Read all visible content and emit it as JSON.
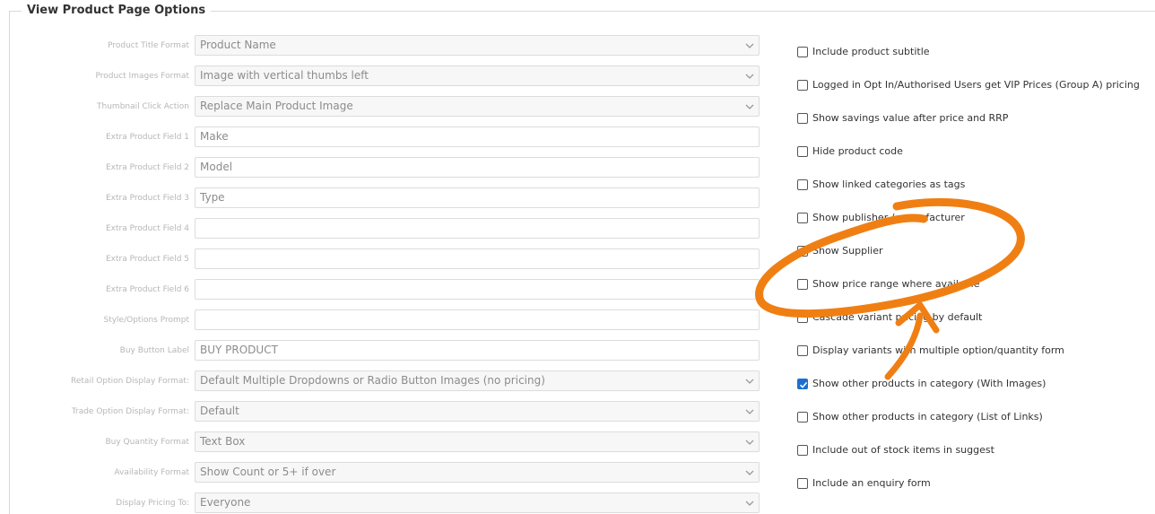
{
  "section": {
    "title": "View Product Page Options"
  },
  "fields": [
    {
      "label": "Product Title Format",
      "value": "Product Name",
      "type": "select"
    },
    {
      "label": "Product Images Format",
      "value": "Image with vertical thumbs left",
      "type": "select"
    },
    {
      "label": "Thumbnail Click Action",
      "value": "Replace Main Product Image",
      "type": "select"
    },
    {
      "label": "Extra Product Field 1",
      "value": "Make",
      "type": "text"
    },
    {
      "label": "Extra Product Field 2",
      "value": "Model",
      "type": "text"
    },
    {
      "label": "Extra Product Field 3",
      "value": "Type",
      "type": "text"
    },
    {
      "label": "Extra Product Field 4",
      "value": "",
      "type": "text"
    },
    {
      "label": "Extra Product Field 5",
      "value": "",
      "type": "text"
    },
    {
      "label": "Extra Product Field 6",
      "value": "",
      "type": "text"
    },
    {
      "label": "Style/Options Prompt",
      "value": "",
      "type": "text"
    },
    {
      "label": "Buy Button Label",
      "value": "BUY PRODUCT",
      "type": "text"
    },
    {
      "label": "Retail Option Display Format:",
      "value": "Default Multiple Dropdowns or Radio Button Images (no pricing)",
      "type": "select"
    },
    {
      "label": "Trade Option Display Format:",
      "value": "Default",
      "type": "select"
    },
    {
      "label": "Buy Quantity Format",
      "value": "Text Box",
      "type": "select"
    },
    {
      "label": "Availability Format",
      "value": "Show Count or 5+ if over",
      "type": "select"
    },
    {
      "label": "Display Pricing To:",
      "value": "Everyone",
      "type": "select"
    }
  ],
  "checkboxes": [
    {
      "label": "Include product subtitle",
      "checked": false
    },
    {
      "label": "Logged in Opt In/Authorised Users get VIP Prices (Group A) pricing",
      "checked": false
    },
    {
      "label": "Show savings value after price and RRP",
      "checked": false
    },
    {
      "label": "Hide product code",
      "checked": false
    },
    {
      "label": "Show linked categories as tags",
      "checked": false
    },
    {
      "label": "Show publisher / manufacturer",
      "checked": false
    },
    {
      "label": "Show Supplier",
      "checked": false
    },
    {
      "label": "Show price range where available",
      "checked": false
    },
    {
      "label": "Cascade variant pricing by default",
      "checked": false
    },
    {
      "label": "Display variants with multiple option/quantity form",
      "checked": false
    },
    {
      "label": "Show other products in category (With Images)",
      "checked": true
    },
    {
      "label": "Show other products in category (List of Links)",
      "checked": false
    },
    {
      "label": "Include out of stock items in suggest",
      "checked": false
    },
    {
      "label": "Include an enquiry form",
      "checked": false
    }
  ],
  "colors": {
    "accent": "#1c6fd0",
    "annotation": "#f07f13"
  }
}
